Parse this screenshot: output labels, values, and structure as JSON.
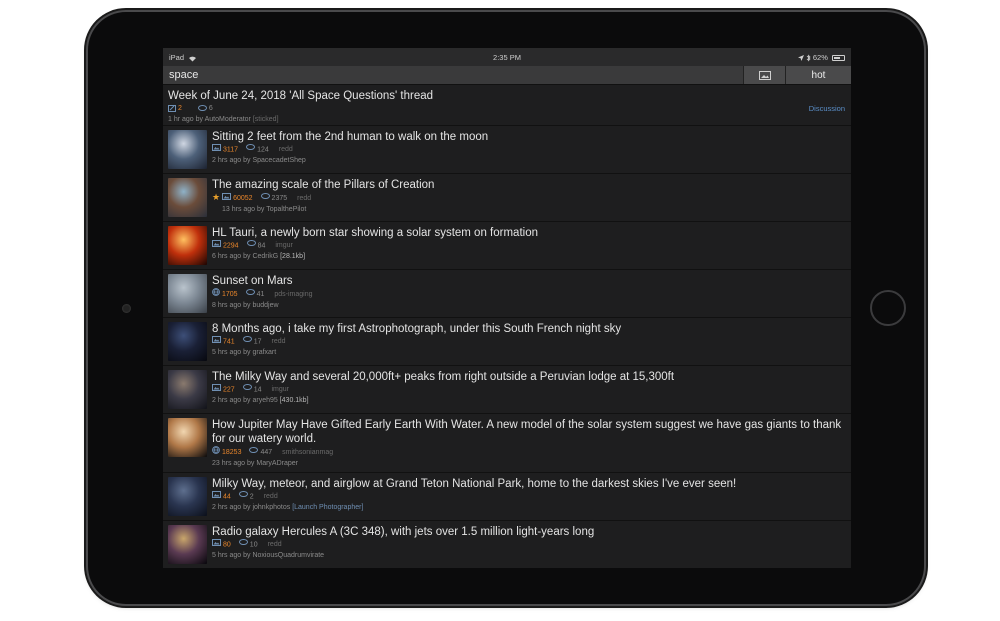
{
  "status_bar": {
    "carrier": "iPad",
    "time": "2:35 PM",
    "battery": "62%",
    "battery_level": 0.62
  },
  "nav": {
    "title": "space",
    "sort_label": "hot"
  },
  "sticky": {
    "title": "Week of June 24, 2018 'All Space Questions' thread",
    "score": "2",
    "comments": "6",
    "age_author": "1 hr ago by AutoModerator",
    "flag": "[sticked]",
    "link_label": "Discussion"
  },
  "posts": [
    {
      "title": "Sitting 2 feet from the 2nd human to walk on the moon",
      "score": "3117",
      "comments": "124",
      "domain": "redd",
      "byline": "2 hrs ago by SpacecadetShep",
      "extra": "",
      "icon": "image-icon",
      "thumb": [
        "#cfd6e2",
        "#4d6079",
        "#1c2230"
      ]
    },
    {
      "title": "The amazing scale of the Pillars of Creation",
      "score": "60052",
      "comments": "2375",
      "domain": "redd",
      "byline": "13 hrs ago by TopalthePilot",
      "extra": "",
      "icon": "image-icon",
      "gilded": true,
      "thumb": [
        "#8fb2c8",
        "#6b4c3a",
        "#2a2f3a"
      ]
    },
    {
      "title": "HL Tauri, a newly born star showing a solar system on formation",
      "score": "2294",
      "comments": "84",
      "domain": "imgur",
      "byline": "6 hrs ago by CedrikG",
      "extra": "[28.1kb]",
      "icon": "image-icon",
      "thumb": [
        "#ffc060",
        "#c0300c",
        "#1a0502"
      ]
    },
    {
      "title": "Sunset on Mars",
      "score": "1705",
      "comments": "41",
      "domain": "pds-imaging",
      "byline": "8 hrs ago by buddjew",
      "extra": "",
      "icon": "globe-icon",
      "thumb": [
        "#b9c3cc",
        "#7d8894",
        "#3a4048"
      ]
    },
    {
      "title": "8 Months ago, i take my first Astrophotograph, under this South French night sky",
      "score": "741",
      "comments": "17",
      "domain": "redd",
      "byline": "5 hrs ago by grafxart",
      "extra": "",
      "icon": "image-icon",
      "thumb": [
        "#3d4f78",
        "#1a2036",
        "#07080e"
      ]
    },
    {
      "title": "The Milky Way and several 20,000ft+ peaks from right outside a Peruvian lodge at 15,300ft",
      "score": "227",
      "comments": "14",
      "domain": "imgur",
      "byline": "2 hrs ago by aryeh95",
      "extra": "[430.1kb]",
      "icon": "image-icon",
      "thumb": [
        "#8a7a6e",
        "#3b3a46",
        "#111218"
      ]
    },
    {
      "title": "How Jupiter May Have Gifted Early Earth With Water. A new model of the solar system suggest we have gas giants to thank for our watery world.",
      "score": "18253",
      "comments": "447",
      "domain": "smithsonianmag",
      "byline": "23 hrs ago by MaryADraper",
      "extra": "",
      "icon": "globe-icon",
      "thumb": [
        "#f1d6b0",
        "#b07848",
        "#0a0a0c"
      ]
    },
    {
      "title": "Milky Way, meteor, and airglow at Grand Teton National Park, home to the darkest skies I've ever seen!",
      "score": "44",
      "comments": "2",
      "domain": "redd",
      "byline": "2 hrs ago by johnkphotos",
      "extra": "[Launch Photographer]",
      "icon": "image-icon",
      "thumb": [
        "#5e6f8e",
        "#2a3550",
        "#0b0f1a"
      ]
    },
    {
      "title": "Radio galaxy Hercules A (3C 348), with jets over 1.5 million light-years long",
      "score": "80",
      "comments": "10",
      "domain": "redd",
      "byline": "5 hrs ago by NoxiousQuadrumvirate",
      "extra": "",
      "icon": "image-icon",
      "thumb": [
        "#c9a66b",
        "#5a3a52",
        "#07060b"
      ]
    }
  ]
}
